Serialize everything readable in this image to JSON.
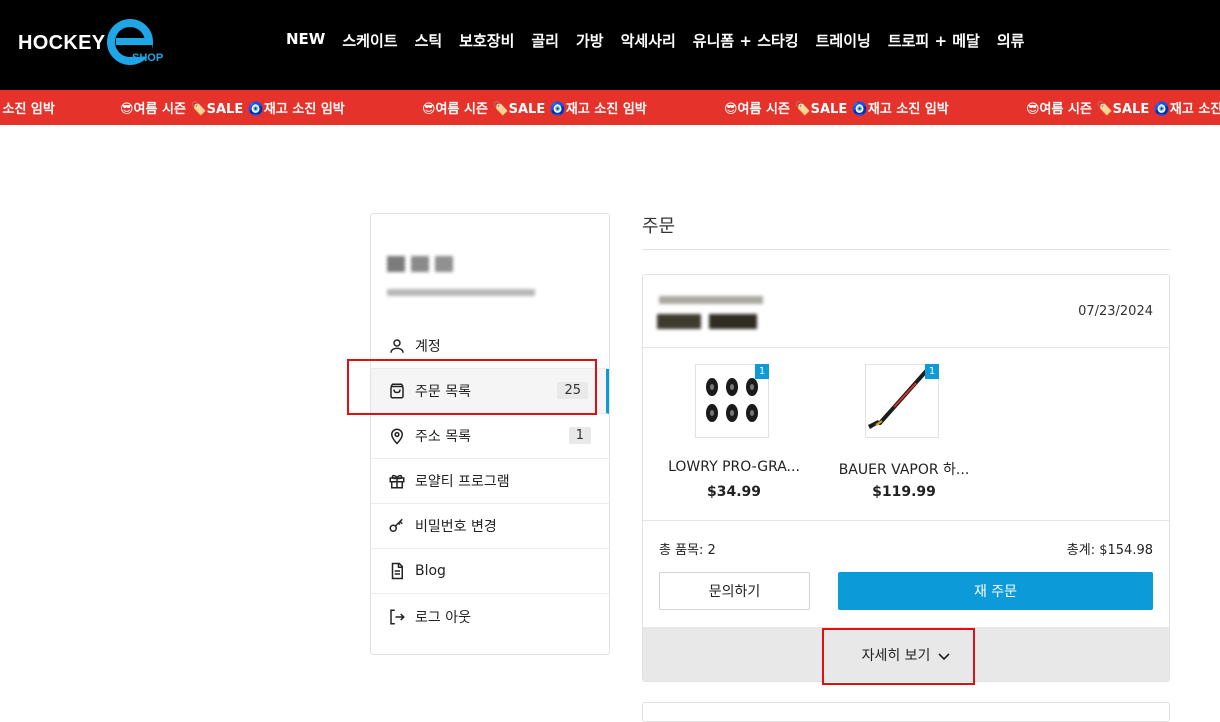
{
  "header": {
    "logo_text": "HOCKEY",
    "logo_sub": "SHOP",
    "nav": [
      "NEW",
      "스케이트",
      "스틱",
      "보호장비",
      "골리",
      "가방",
      "악세사리",
      "유니폼 + 스타킹",
      "트레이닝",
      "트로피 + 메달",
      "의류"
    ]
  },
  "ticker": {
    "text": "😎여름 시즌 🏷️SALE 🧿재고 소진 임박",
    "leading_fragment": "고 소진 임박"
  },
  "sidebar": {
    "menu": [
      {
        "label": "계정",
        "icon": "user-icon"
      },
      {
        "label": "주문 목록",
        "icon": "shopping-bag-icon",
        "count": "25"
      },
      {
        "label": "주소 목록",
        "icon": "map-pin-icon",
        "count": "1"
      },
      {
        "label": "로얄티 프로그램",
        "icon": "gift-icon"
      },
      {
        "label": "비밀번호 변경",
        "icon": "key-icon"
      },
      {
        "label": "Blog",
        "icon": "document-icon"
      },
      {
        "label": "로그 아웃",
        "icon": "logout-icon"
      }
    ]
  },
  "orders": {
    "title": "주문",
    "card": {
      "date": "07/23/2024",
      "products": [
        {
          "name": "LOWRY PRO-GRA...",
          "price": "$34.99",
          "qty": "1",
          "icon": "puck-wheels-icon"
        },
        {
          "name": "BAUER VAPOR 하...",
          "price": "$119.99",
          "qty": "1",
          "icon": "hockey-stick-icon"
        }
      ],
      "total_items": "총 품목: 2",
      "total_amount": "총계: $154.98",
      "inquiry_label": "문의하기",
      "reorder_label": "재 주문",
      "details_label": "자세히 보기"
    }
  },
  "colors": {
    "header_bg": "#000000",
    "ticker_bg": "#e5322a",
    "accent": "#0c9ad8",
    "highlight": "#e01010"
  }
}
